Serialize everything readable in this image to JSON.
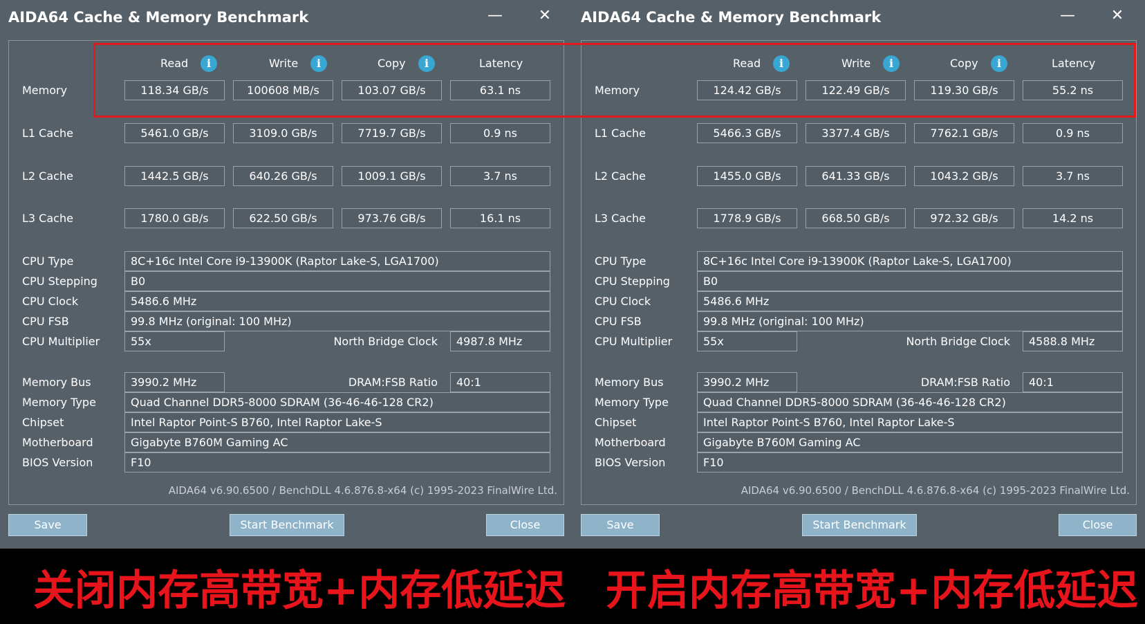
{
  "colors": {
    "panel_bg": "#556069",
    "highlight": "#e21a1a",
    "caption": "#e8141b",
    "button_bg": "#8fb3c9",
    "info_icon": "#39a7d3"
  },
  "headers": {
    "read": "Read",
    "write": "Write",
    "copy": "Copy",
    "latency": "Latency"
  },
  "row_labels": {
    "memory": "Memory",
    "l1": "L1 Cache",
    "l2": "L2 Cache",
    "l3": "L3 Cache",
    "cpu_type": "CPU Type",
    "cpu_stepping": "CPU Stepping",
    "cpu_clock": "CPU Clock",
    "cpu_fsb": "CPU FSB",
    "cpu_multiplier": "CPU Multiplier",
    "nb_clock": "North Bridge Clock",
    "memory_bus": "Memory Bus",
    "dram_fsb": "DRAM:FSB Ratio",
    "memory_type": "Memory Type",
    "chipset": "Chipset",
    "motherboard": "Motherboard",
    "bios": "BIOS Version"
  },
  "buttons": {
    "save": "Save",
    "start": "Start Benchmark",
    "close": "Close"
  },
  "windows": [
    {
      "title": "AIDA64 Cache & Memory Benchmark",
      "caption": "关闭内存高带宽+内存低延迟",
      "memory": {
        "read": "118.34 GB/s",
        "write": "100608 MB/s",
        "copy": "103.07 GB/s",
        "latency": "63.1 ns"
      },
      "l1": {
        "read": "5461.0 GB/s",
        "write": "3109.0 GB/s",
        "copy": "7719.7 GB/s",
        "latency": "0.9 ns"
      },
      "l2": {
        "read": "1442.5 GB/s",
        "write": "640.26 GB/s",
        "copy": "1009.1 GB/s",
        "latency": "3.7 ns"
      },
      "l3": {
        "read": "1780.0 GB/s",
        "write": "622.50 GB/s",
        "copy": "973.76 GB/s",
        "latency": "16.1 ns"
      },
      "cpu_type": "8C+16c Intel Core i9-13900K  (Raptor Lake-S, LGA1700)",
      "cpu_stepping": "B0",
      "cpu_clock": "5486.6 MHz",
      "cpu_fsb": "99.8 MHz  (original: 100 MHz)",
      "cpu_multiplier": "55x",
      "nb_clock": "4987.8 MHz",
      "memory_bus": "3990.2 MHz",
      "dram_fsb": "40:1",
      "memory_type": "Quad Channel DDR5-8000 SDRAM  (36-46-46-128 CR2)",
      "chipset": "Intel Raptor Point-S B760, Intel Raptor Lake-S",
      "motherboard": "Gigabyte B760M Gaming AC",
      "bios": "F10",
      "footer": "AIDA64 v6.90.6500 / BenchDLL 4.6.876.8-x64  (c) 1995-2023 FinalWire Ltd."
    },
    {
      "title": "AIDA64 Cache & Memory Benchmark",
      "caption": "开启内存高带宽+内存低延迟",
      "memory": {
        "read": "124.42 GB/s",
        "write": "122.49 GB/s",
        "copy": "119.30 GB/s",
        "latency": "55.2 ns"
      },
      "l1": {
        "read": "5466.3 GB/s",
        "write": "3377.4 GB/s",
        "copy": "7762.1 GB/s",
        "latency": "0.9 ns"
      },
      "l2": {
        "read": "1455.0 GB/s",
        "write": "641.33 GB/s",
        "copy": "1043.2 GB/s",
        "latency": "3.7 ns"
      },
      "l3": {
        "read": "1778.9 GB/s",
        "write": "668.50 GB/s",
        "copy": "972.32 GB/s",
        "latency": "14.2 ns"
      },
      "cpu_type": "8C+16c Intel Core i9-13900K  (Raptor Lake-S, LGA1700)",
      "cpu_stepping": "B0",
      "cpu_clock": "5486.6 MHz",
      "cpu_fsb": "99.8 MHz  (original: 100 MHz)",
      "cpu_multiplier": "55x",
      "nb_clock": "4588.8 MHz",
      "memory_bus": "3990.2 MHz",
      "dram_fsb": "40:1",
      "memory_type": "Quad Channel DDR5-8000 SDRAM  (36-46-46-128 CR2)",
      "chipset": "Intel Raptor Point-S B760, Intel Raptor Lake-S",
      "motherboard": "Gigabyte B760M Gaming AC",
      "bios": "F10",
      "footer": "AIDA64 v6.90.6500 / BenchDLL 4.6.876.8-x64  (c) 1995-2023 FinalWire Ltd."
    }
  ]
}
